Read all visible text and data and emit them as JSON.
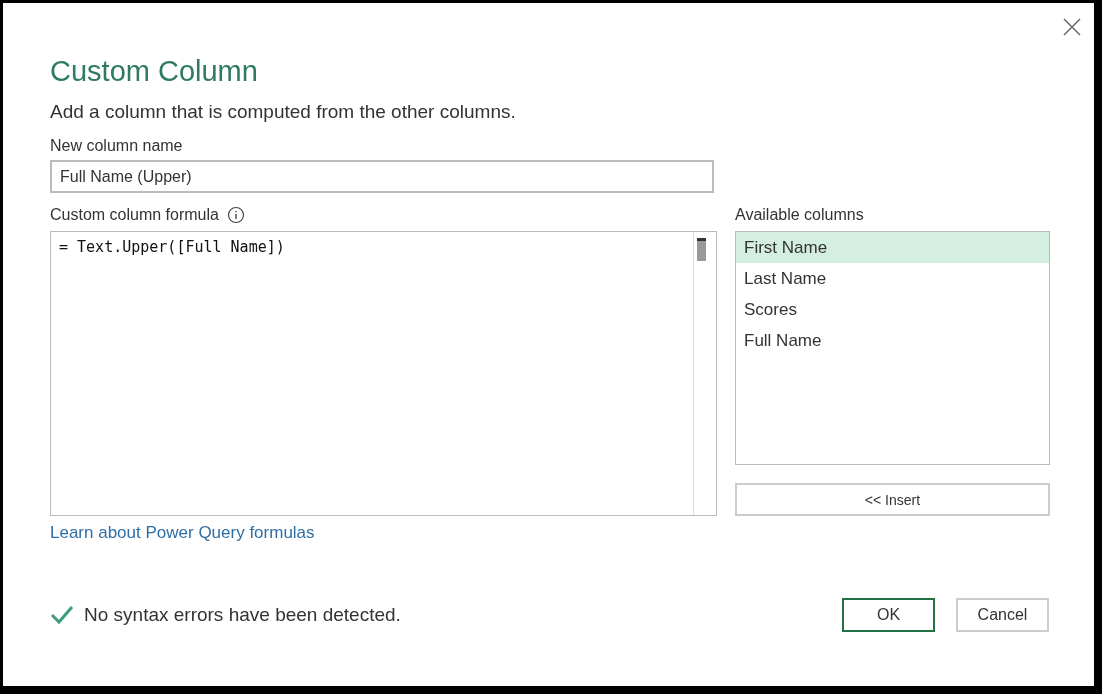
{
  "dialog": {
    "title": "Custom Column",
    "description": "Add a column that is computed from the other columns."
  },
  "name_field": {
    "label": "New column name",
    "value": "Full Name (Upper)"
  },
  "formula": {
    "label": "Custom column formula",
    "value": "= Text.Upper([Full Name])"
  },
  "available_columns": {
    "label": "Available columns",
    "items": [
      {
        "label": "First Name",
        "selected": true
      },
      {
        "label": "Last Name",
        "selected": false
      },
      {
        "label": "Scores",
        "selected": false
      },
      {
        "label": "Full Name",
        "selected": false
      }
    ],
    "insert_button": "<< Insert"
  },
  "link": "Learn about Power Query formulas",
  "status": "No syntax errors have been detected.",
  "buttons": [
    {
      "label": "OK",
      "kind": "primary"
    },
    {
      "label": "Cancel",
      "kind": "secondary"
    }
  ]
}
